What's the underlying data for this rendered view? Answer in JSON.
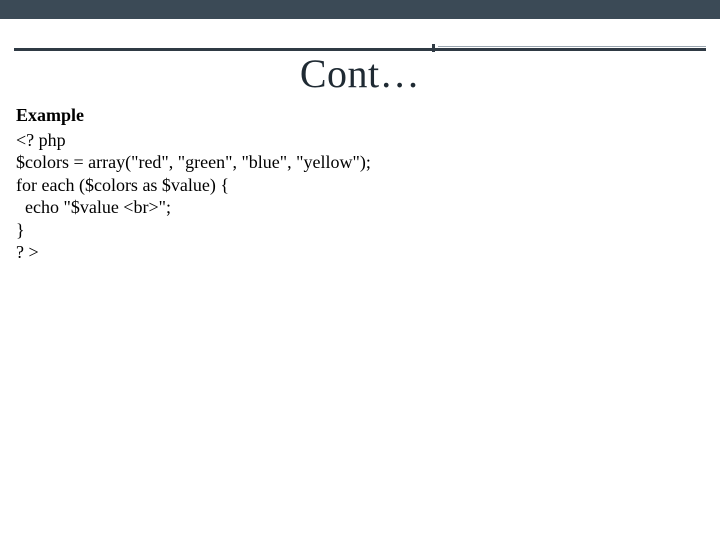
{
  "title": "Cont…",
  "example_label": "Example",
  "code": "<? php\n$colors = array(\"red\", \"green\", \"blue\", \"yellow\");\nfor each ($colors as $value) {\n  echo \"$value <br>\";\n}\n? >"
}
